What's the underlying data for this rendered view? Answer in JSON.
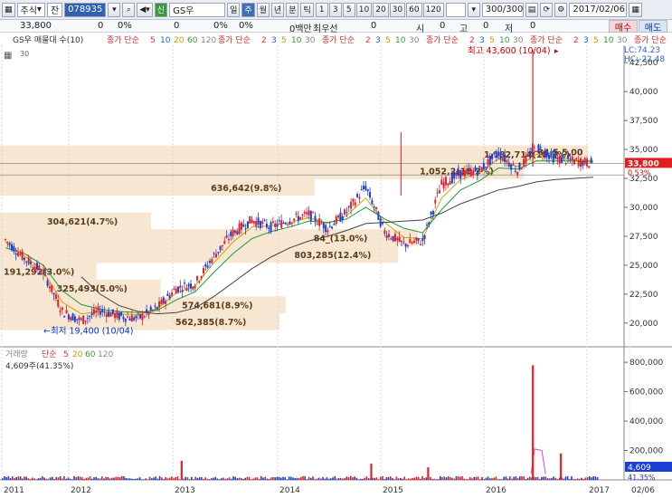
{
  "toolbar": {
    "market_select": "주식",
    "market_select2": "잔",
    "code_value": "078935",
    "badge": "신",
    "stock_name": "GS우",
    "period_day": "일",
    "period_week": "주",
    "period_month": "월",
    "period_year": "년",
    "period_minute": "분",
    "period_tick": "틱",
    "intervals": [
      "1",
      "3",
      "5",
      "10",
      "20",
      "30",
      "60",
      "120"
    ],
    "count": "300/300",
    "date": "2017/02/06"
  },
  "infobar": {
    "price": "33,800",
    "change": "0",
    "change_pct": "0%",
    "volume": "0",
    "volume_pct": "0%",
    "amount": "0",
    "amount_pct": "0%",
    "amount_unit": "0백만",
    "low_label": "최우선",
    "v1": "0",
    "v2": "0",
    "open_label": "시",
    "open": "0",
    "high_label": "고",
    "high": "0",
    "low2_label": "저",
    "low": "0",
    "buy_label": "매수",
    "sell_label": "매도"
  },
  "legend": {
    "price_title": "GS우 매물대 수(10)",
    "ma_groups": [
      {
        "label": "종가 단순",
        "periods": [
          "5",
          "10",
          "20",
          "60",
          "120"
        ],
        "colors": [
          "#d33",
          "#16c",
          "#c90",
          "#393",
          "#888"
        ]
      },
      {
        "label": "종가 단순",
        "periods": [
          "2",
          "3",
          "5",
          "10",
          "30"
        ],
        "colors": [
          "#d33",
          "#16c",
          "#c90",
          "#393",
          "#888"
        ]
      },
      {
        "label": "종가 단순",
        "periods": [
          "2",
          "3",
          "5",
          "10",
          "30"
        ],
        "colors": [
          "#d33",
          "#16c",
          "#c90",
          "#393",
          "#888"
        ]
      },
      {
        "label": "종가 단순",
        "periods": [
          "2",
          "3",
          "5",
          "10",
          "30"
        ],
        "colors": [
          "#d33",
          "#16c",
          "#c90",
          "#393",
          "#888"
        ]
      },
      {
        "label": "종가 단순",
        "periods": [
          "2",
          "3",
          "5",
          "10",
          "30"
        ],
        "colors": [
          "#d33",
          "#16c",
          "#c90",
          "#393",
          "#888"
        ]
      },
      {
        "label": "종가 단순",
        "periods": [
          "2",
          "3",
          "5"
        ],
        "colors": [
          "#d33",
          "#16c",
          "#c90"
        ]
      }
    ],
    "small_value": "30",
    "volume_title": "거래량",
    "volume_ma": {
      "label": "단순",
      "periods": [
        "5",
        "20",
        "60",
        "120"
      ],
      "colors": [
        "#d33",
        "#c90",
        "#393",
        "#888"
      ]
    },
    "volume_now": "4,609주(41.35%)"
  },
  "indicators": {
    "lc": "LC:74.23",
    "hc": "HC:-22.48"
  },
  "annotations": {
    "high": "최고 43,600 (10/04)",
    "low": "최저 19,400 (10/04)"
  },
  "current_price_tag": "33,800",
  "current_pct_tag": "0.53%",
  "volume_tag": "4,609",
  "volume_pct_tag": "41.35%",
  "chart_data": [
    {
      "type": "line",
      "title": "GS우 매물대 수(10)",
      "y_ticks": [
        "42,500",
        "40,000",
        "37,500",
        "35,000",
        "32,500",
        "30,000",
        "27,500",
        "25,000",
        "22,500",
        "20,000"
      ],
      "x_ticks": [
        "2011",
        "2012",
        "2013",
        "2014",
        "2015",
        "2016",
        "2017",
        "02/06"
      ],
      "ylim": [
        18500,
        44000
      ],
      "volume_profile": [
        {
          "label": "562,385(8.7%)",
          "low": 19400,
          "high": 20850,
          "share": 8.7
        },
        {
          "label": "574,681(8.9%)",
          "low": 20850,
          "high": 22300,
          "share": 8.9
        },
        {
          "label": "325,493(5.0%)",
          "low": 22300,
          "high": 23750,
          "share": 5.0
        },
        {
          "label": "191,292(3.0%)",
          "low": 23750,
          "high": 25200,
          "share": 3.0
        },
        {
          "label": "803,285(12.4%)",
          "low": 25200,
          "high": 26650,
          "share": 12.4
        },
        {
          "label": "304,621(4.7%)",
          "low": 28100,
          "high": 29550,
          "share": 4.7
        },
        {
          "label": "636,642(9.8%)",
          "low": 31000,
          "high": 32450,
          "share": 9.8
        },
        {
          "label": "1,052,2(16.3%)",
          "low": 32450,
          "high": 33900,
          "share": 16.3
        },
        {
          "label": "1,182,714(18.3%)",
          "low": 33900,
          "high": 35350,
          "share": 18.3
        },
        {
          "label": "84_(13.0%)",
          "low": 26650,
          "high": 28100,
          "share": 13.0
        },
        {
          "label": "~ 34,5 5,00",
          "low": 34000,
          "high": 35000,
          "share": 0
        }
      ],
      "series": [
        {
          "name": "price",
          "values": [
            27200,
            25600,
            24400,
            21000,
            20200,
            21100,
            20600,
            20400,
            21300,
            23000,
            23400,
            25800,
            27800,
            28900,
            28300,
            28900,
            29400,
            28200,
            29600,
            31800,
            27900,
            26800,
            27100,
            32000,
            32900,
            33200,
            34700,
            33200,
            35200,
            34200,
            34000,
            33800
          ]
        },
        {
          "name": "ma20",
          "values": [
            27000,
            25800,
            24500,
            21800,
            20800,
            21000,
            20800,
            20700,
            21200,
            22600,
            23200,
            25200,
            27000,
            28300,
            28400,
            28700,
            29100,
            28600,
            29300,
            30800,
            28700,
            27400,
            27300,
            30800,
            32400,
            33000,
            34200,
            33500,
            34600,
            34300,
            34100,
            34000
          ]
        },
        {
          "name": "ma60",
          "values": [
            26500,
            26000,
            25000,
            22800,
            21600,
            21200,
            21000,
            20900,
            21100,
            22000,
            22700,
            24400,
            26000,
            27300,
            27900,
            28300,
            28800,
            28700,
            29000,
            30000,
            29000,
            28200,
            27800,
            29800,
            31500,
            32300,
            33400,
            33300,
            34000,
            34000,
            34000,
            33900
          ]
        },
        {
          "name": "ma120",
          "values": [
            null,
            null,
            null,
            null,
            24000,
            22500,
            21500,
            21000,
            20800,
            20900,
            21300,
            22300,
            23500,
            24700,
            25700,
            26500,
            27100,
            27500,
            28000,
            28600,
            28700,
            28800,
            28900,
            29500,
            30300,
            30900,
            31500,
            31800,
            32200,
            32400,
            32500,
            32600
          ]
        }
      ],
      "volume": {
        "ylim": [
          0,
          850000
        ],
        "y_ticks": [
          "800,000",
          "600,000",
          "400,000",
          "200,000"
        ],
        "spikes": [
          {
            "date_index": 9,
            "value": 130000
          },
          {
            "date_index": 19,
            "value": 110000
          },
          {
            "date_index": 22,
            "value": 85000
          },
          {
            "date_index": 28,
            "value": 780000
          },
          {
            "date_index": 29,
            "value": 180000
          }
        ]
      }
    }
  ]
}
